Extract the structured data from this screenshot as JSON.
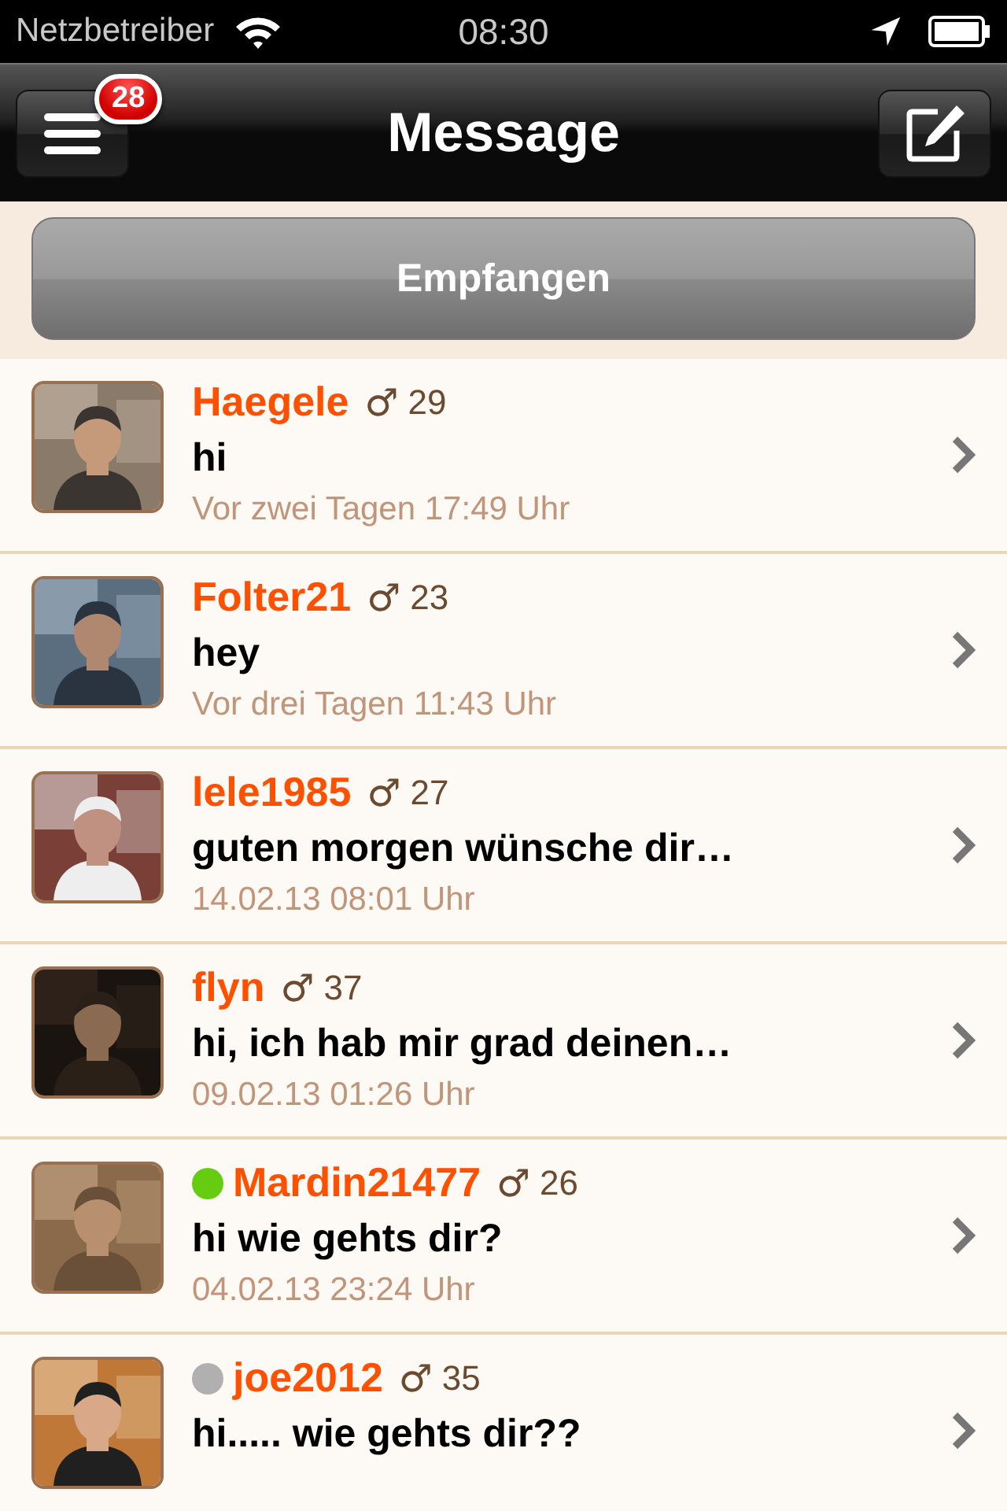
{
  "status_bar": {
    "carrier": "Netzbetreiber",
    "time": "08:30"
  },
  "nav_bar": {
    "title": "Message",
    "badge": "28"
  },
  "segment": {
    "label": "Empfangen"
  },
  "messages": [
    {
      "name": "Haegele",
      "gender": "♂",
      "age": "29",
      "text": "hi",
      "date": "Vor zwei Tagen 17:49 Uhr"
    },
    {
      "name": "Folter21",
      "gender": "♂",
      "age": "23",
      "text": "hey",
      "date": "Vor drei Tagen 11:43 Uhr"
    },
    {
      "name": "lele1985",
      "gender": "♂",
      "age": "27",
      "text": "guten morgen wünsche dir…",
      "date": "14.02.13 08:01 Uhr"
    },
    {
      "name": "flyn",
      "gender": "♂",
      "age": "37",
      "text": "hi, ich hab mir grad deinen…",
      "date": "09.02.13 01:26 Uhr"
    },
    {
      "name": "Mardin21477",
      "gender": "♂",
      "age": "26",
      "text": "hi wie gehts dir?",
      "date": "04.02.13 23:24 Uhr",
      "color": "#66cc11"
    },
    {
      "name": "joe2012",
      "gender": "♂",
      "age": "35",
      "text": "hi..... wie gehts dir??",
      "color": "#b0b0b0"
    }
  ]
}
